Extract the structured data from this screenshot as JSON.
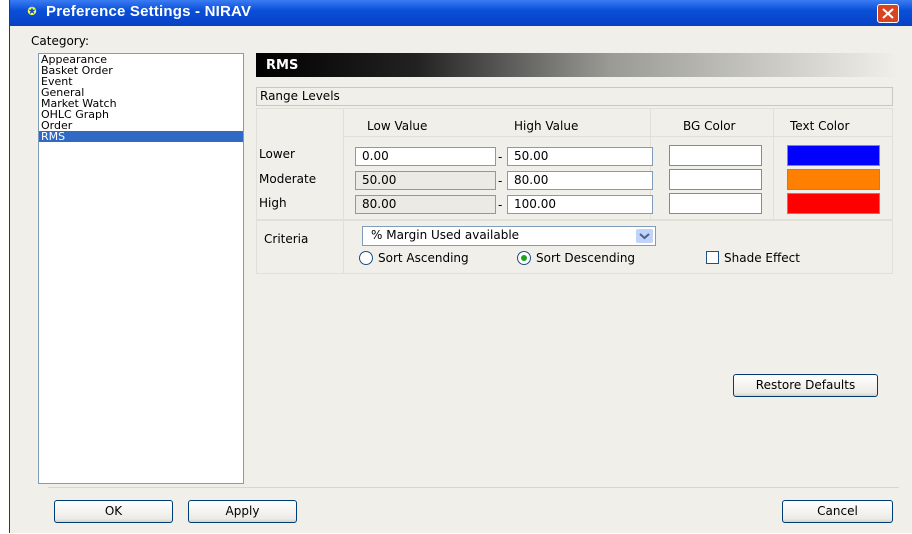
{
  "window": {
    "title": "Preference Settings - NIRAV"
  },
  "category": {
    "label": "Category:",
    "items": [
      "Appearance",
      "Basket Order",
      "Event",
      "General",
      "Market Watch",
      "OHLC Graph",
      "Order",
      "RMS"
    ],
    "selected": "RMS"
  },
  "panel": {
    "title": "RMS",
    "range_levels_label": "Range Levels",
    "columns": {
      "low": "Low Value",
      "high": "High Value",
      "bg": "BG Color",
      "text": "Text Color"
    },
    "rows": [
      {
        "label": "Lower",
        "low": "0.00",
        "high": "50.00",
        "bg_color": "#ffffff",
        "text_color": "#0000ff"
      },
      {
        "label": "Moderate",
        "low": "50.00",
        "high": "80.00",
        "bg_color": "#ffffff",
        "text_color": "#ff8000"
      },
      {
        "label": "High",
        "low": "80.00",
        "high": "100.00",
        "bg_color": "#ffffff",
        "text_color": "#ff0000"
      }
    ],
    "separator": "-",
    "criteria_label": "Criteria",
    "criteria_value": "% Margin Used available",
    "sort_ascending": "Sort Ascending",
    "sort_descending": "Sort Descending",
    "sort_selected": "descending",
    "shade_effect": "Shade Effect",
    "shade_checked": false,
    "restore_defaults": "Restore Defaults"
  },
  "buttons": {
    "ok": "OK",
    "apply": "Apply",
    "cancel": "Cancel"
  },
  "colors": {
    "title_bar": "#0a4fd8",
    "selection": "#316ac5",
    "close": "#d9431f"
  }
}
